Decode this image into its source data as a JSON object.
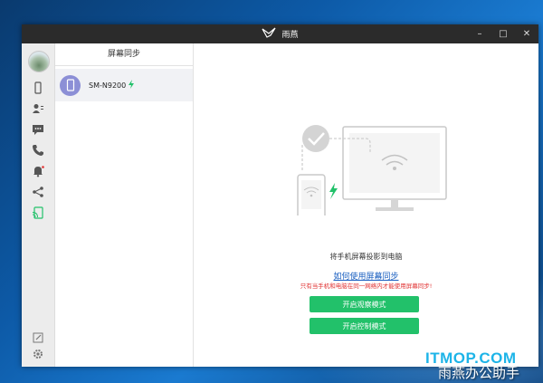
{
  "window": {
    "title": "雨燕"
  },
  "controls": {
    "minimize": "–",
    "maximize": "□",
    "close": "✕"
  },
  "sidebar": {
    "icons": [
      "phone-icon",
      "contacts-icon",
      "messages-icon",
      "call-icon",
      "notification-icon",
      "share-icon",
      "screen-cast-icon"
    ],
    "bottom_icons": [
      "edit-icon",
      "settings-icon"
    ],
    "active_color": "#22c16a"
  },
  "panel": {
    "title": "屏幕同步",
    "devices": [
      {
        "name": "SM-N9200"
      }
    ]
  },
  "main": {
    "caption": "将手机屏幕投影到电脑",
    "help_link": "如何使用屏幕同步",
    "warning": "只有当手机和电脑在同一网络内才能使用屏幕同步!",
    "buttons": {
      "watch": "开启观察模式",
      "control": "开启控制模式"
    },
    "colors": {
      "accent": "#22c16a",
      "link": "#1a5fc0",
      "warning": "#e03030"
    }
  },
  "watermark": {
    "site": "ITMOP.COM",
    "label": "雨燕办公助手"
  }
}
